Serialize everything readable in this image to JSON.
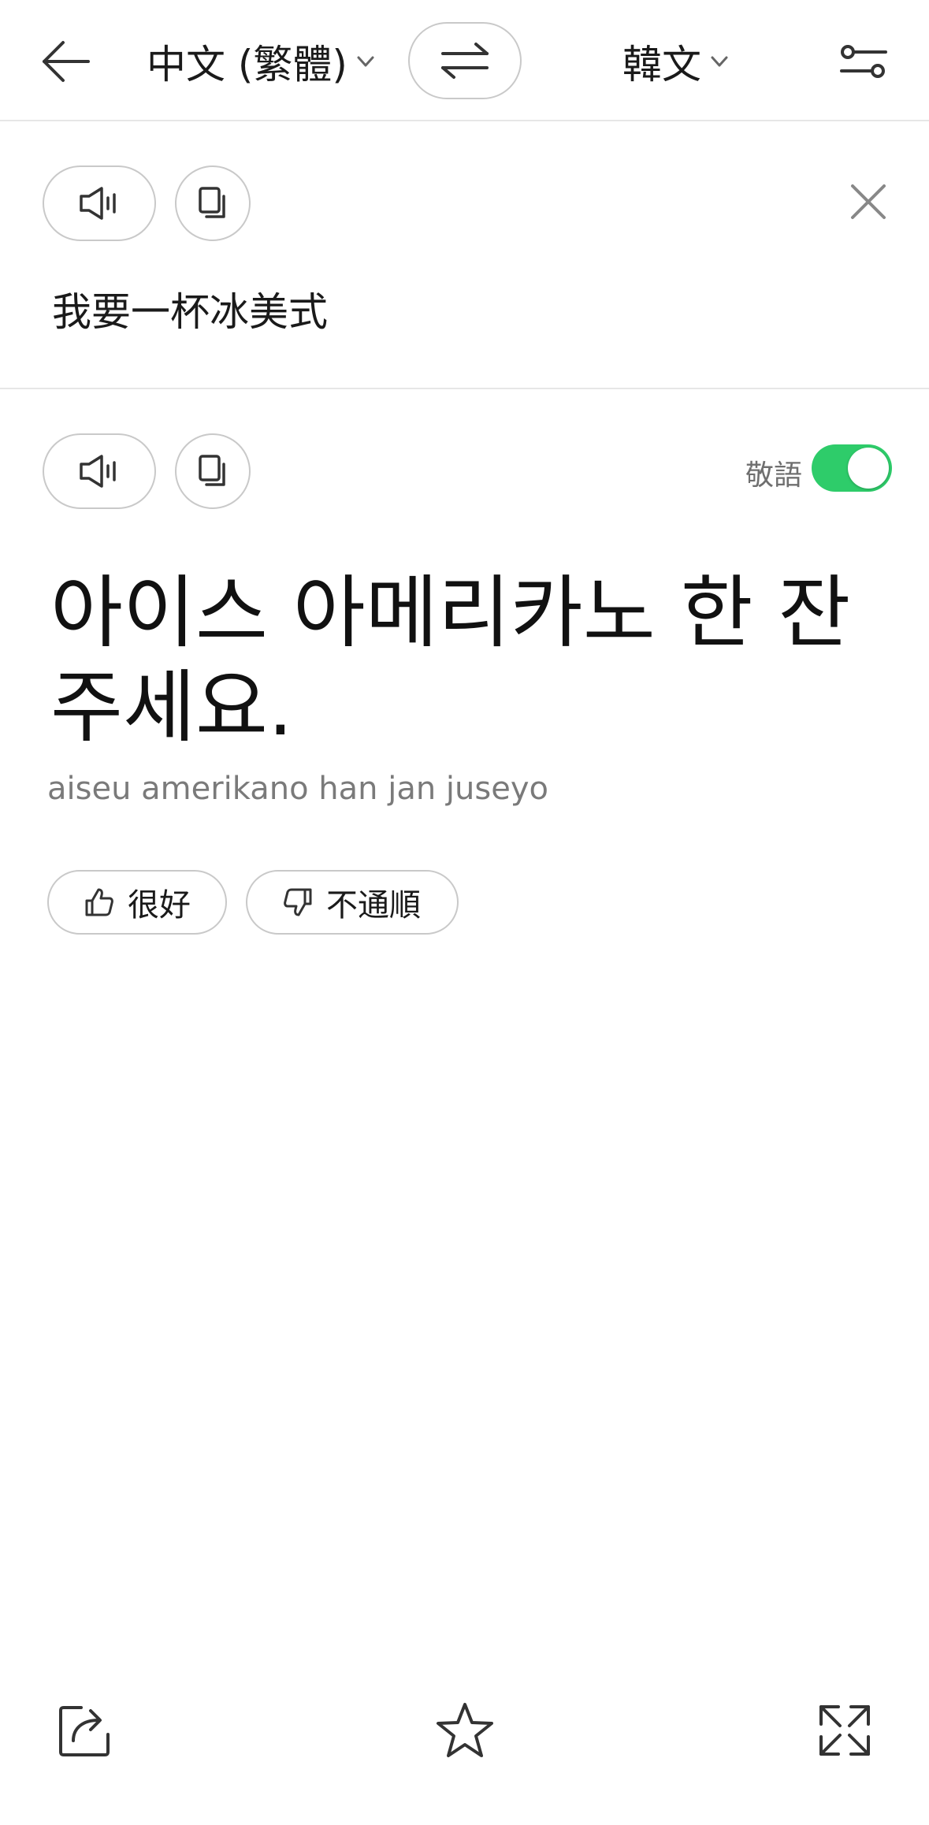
{
  "header": {
    "source_language": "中文 (繁體)",
    "target_language": "韓文"
  },
  "source": {
    "text": "我要一杯冰美式"
  },
  "result": {
    "honorific_label": "敬語",
    "honorific_enabled": true,
    "translation": "아이스 아메리카노 한 잔 주세요.",
    "romanization": "aiseu amerikano han jan juseyo",
    "feedback_good": "很好",
    "feedback_bad": "不通順"
  },
  "colors": {
    "toggle_on": "#2ecc6a",
    "text_primary": "#1a1a1a",
    "text_secondary": "#7a7a7a",
    "border": "#c9c9c9"
  },
  "icons": {
    "back": "arrow-left-icon",
    "swap": "swap-arrows-icon",
    "settings": "sliders-icon",
    "speak": "speaker-icon",
    "copy": "copy-icon",
    "close": "close-icon",
    "thumbs_up": "thumbs-up-icon",
    "thumbs_down": "thumbs-down-icon",
    "share": "share-icon",
    "favorite": "star-icon",
    "expand": "expand-icon"
  }
}
